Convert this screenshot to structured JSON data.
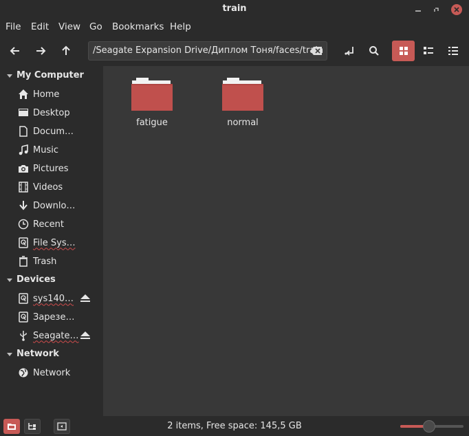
{
  "window": {
    "title": "train"
  },
  "menu": [
    "File",
    "Edit",
    "View",
    "Go",
    "Bookmarks",
    "Help"
  ],
  "location": {
    "path": "/Seagate Expansion Drive/Диплом Тоня/faces/train"
  },
  "sidebar": {
    "sections": [
      {
        "label": "My Computer",
        "items": [
          {
            "label": "Home",
            "icon": "home-icon"
          },
          {
            "label": "Desktop",
            "icon": "desktop-icon"
          },
          {
            "label": "Docum…",
            "icon": "document-icon"
          },
          {
            "label": "Music",
            "icon": "music-icon"
          },
          {
            "label": "Pictures",
            "icon": "camera-icon"
          },
          {
            "label": "Videos",
            "icon": "film-icon"
          },
          {
            "label": "Downlo…",
            "icon": "download-icon"
          },
          {
            "label": "Recent",
            "icon": "clock-icon"
          },
          {
            "label": "File Sys…",
            "icon": "drive-icon"
          },
          {
            "label": "Trash",
            "icon": "trash-icon"
          }
        ]
      },
      {
        "label": "Devices",
        "items": [
          {
            "label": "sys140…",
            "icon": "drive-icon"
          },
          {
            "label": "Зарезе…",
            "icon": "drive-icon"
          },
          {
            "label": "Seagate…",
            "icon": "usb-icon"
          }
        ]
      },
      {
        "label": "Network",
        "items": [
          {
            "label": "Network",
            "icon": "network-icon"
          }
        ]
      }
    ]
  },
  "files": [
    {
      "name": "fatigue",
      "icon": "folder-icon"
    },
    {
      "name": "normal",
      "icon": "folder-icon"
    }
  ],
  "status": {
    "text": "2 items, Free space: 145,5 GB"
  },
  "zoom": {
    "level": 0.46
  },
  "colors": {
    "accent": "#c75a56",
    "folder": "#c0504d"
  }
}
